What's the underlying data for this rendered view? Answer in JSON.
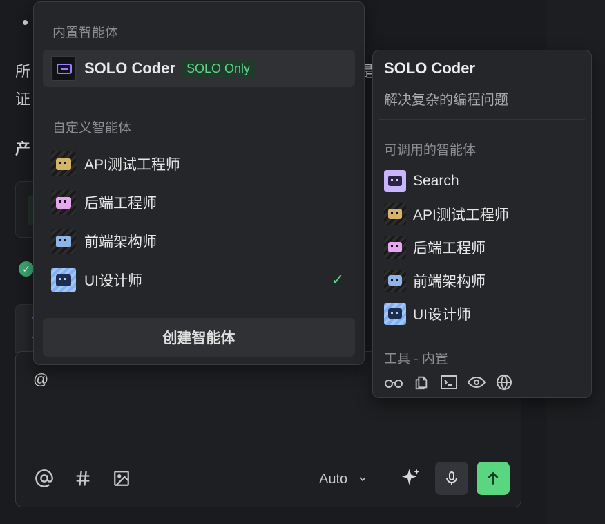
{
  "background": {
    "line1_prefix": "所",
    "line2_prefix": "证",
    "heading_prefix": "产",
    "line1_suffix": "是"
  },
  "dropdown": {
    "builtin_section": "内置智能体",
    "solo_item": {
      "label": "SOLO Coder",
      "badge": "SOLO Only"
    },
    "custom_section": "自定义智能体",
    "custom_items": [
      {
        "label": "API测试工程师",
        "avatar": "api-tester-avatar"
      },
      {
        "label": "后端工程师",
        "avatar": "backend-avatar"
      },
      {
        "label": "前端架构师",
        "avatar": "frontend-avatar"
      },
      {
        "label": "UI设计师",
        "avatar": "ui-designer-avatar",
        "selected": true
      }
    ],
    "check_glyph": "✓",
    "create_label": "创建智能体"
  },
  "panel": {
    "title": "SOLO Coder",
    "description": "解决复杂的编程问题",
    "callable_section": "可调用的智能体",
    "callable_items": [
      {
        "label": "Search"
      },
      {
        "label": "API测试工程师"
      },
      {
        "label": "后端工程师"
      },
      {
        "label": "前端架构师"
      },
      {
        "label": "UI设计师"
      }
    ],
    "tools_section": "工具 - 内置",
    "tools": [
      "glasses-icon",
      "copy-icon",
      "terminal-icon",
      "eye-icon",
      "globe-icon"
    ]
  },
  "composer": {
    "text": "@",
    "model": "Auto",
    "icons": [
      "at-icon",
      "hash-icon",
      "image-icon",
      "sparkle-icon",
      "mic-icon",
      "send-arrow-icon"
    ]
  },
  "colors": {
    "accent_green": "#5ad680",
    "badge_bg": "#223a2c",
    "panel_bg": "#252629",
    "page_bg": "#1a1b1e"
  }
}
